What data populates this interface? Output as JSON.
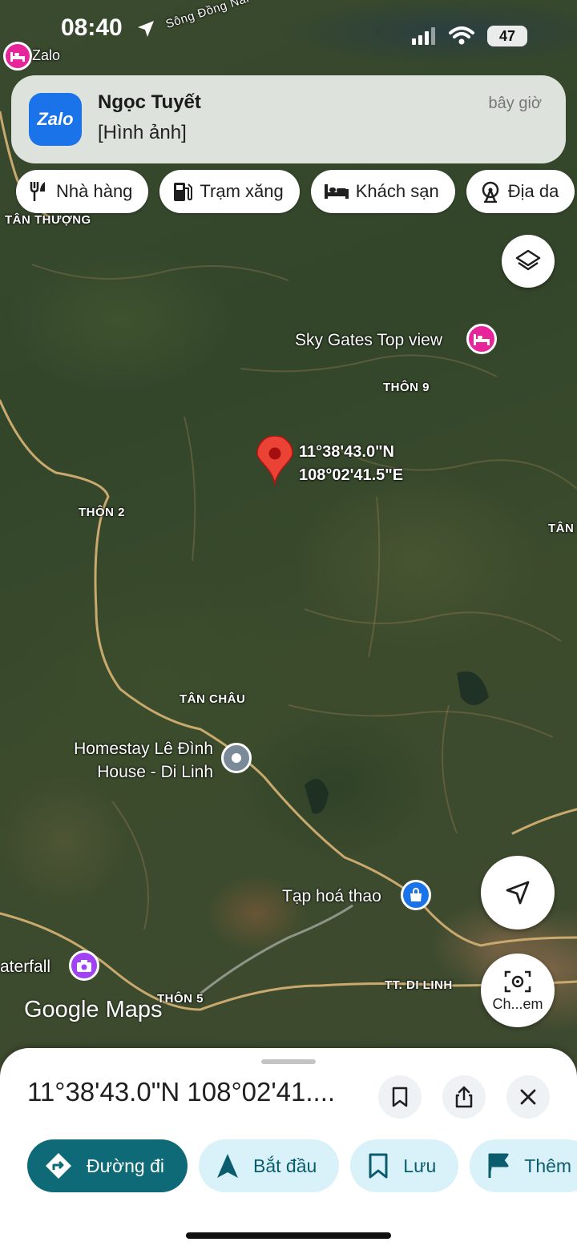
{
  "status": {
    "time": "08:40",
    "battery": "47"
  },
  "map": {
    "river_label": "Sông Đồng Nai",
    "places": {
      "tan_thuong": "TÂN THƯỢNG",
      "thon_9": "THÔN 9",
      "thon_2": "THÔN 2",
      "tan_right": "TÂN",
      "tan_chau": "TÂN CHÂU",
      "thon_5": "THÔN 5",
      "tt_di_linh": "TT. DI LINH"
    },
    "pois": {
      "zalo": "Zalo",
      "sky_gates": "Sky Gates Top view",
      "homestay_line1": "Homestay Lê Đình",
      "homestay_line2": "House - Di Linh",
      "tap_hoa": "Tạp hoá thao",
      "waterfall": "aterfall"
    },
    "pin": {
      "lat": "11°38'43.0\"N",
      "lng": "108°02'41.5\"E"
    },
    "google_logo": "Google Maps",
    "lens_label": "Ch...em"
  },
  "notification": {
    "app_icon_text": "Zalo",
    "title": "Ngọc Tuyết",
    "body": "[Hình ảnh]",
    "time": "bây giờ"
  },
  "chips": [
    {
      "label": "Nhà hàng",
      "icon": "fork-knife-icon"
    },
    {
      "label": "Trạm xăng",
      "icon": "gas-station-icon"
    },
    {
      "label": "Khách sạn",
      "icon": "bed-icon"
    },
    {
      "label": "Địa da",
      "icon": "ferris-wheel-icon"
    }
  ],
  "sheet": {
    "title": "11°38'43.0\"N 108°02'41....",
    "actions": [
      {
        "label": "Đường đi",
        "icon": "directions-icon"
      },
      {
        "label": "Bắt đầu",
        "icon": "navigation-arrow-icon"
      },
      {
        "label": "Lưu",
        "icon": "bookmark-icon"
      },
      {
        "label": "Thêm",
        "icon": "flag-icon"
      }
    ]
  },
  "colors": {
    "pin_red": "#ea4335",
    "hotel_pink": "#e8249a",
    "primary_teal": "#0f6a78",
    "chip_light": "#d9f1f9"
  }
}
